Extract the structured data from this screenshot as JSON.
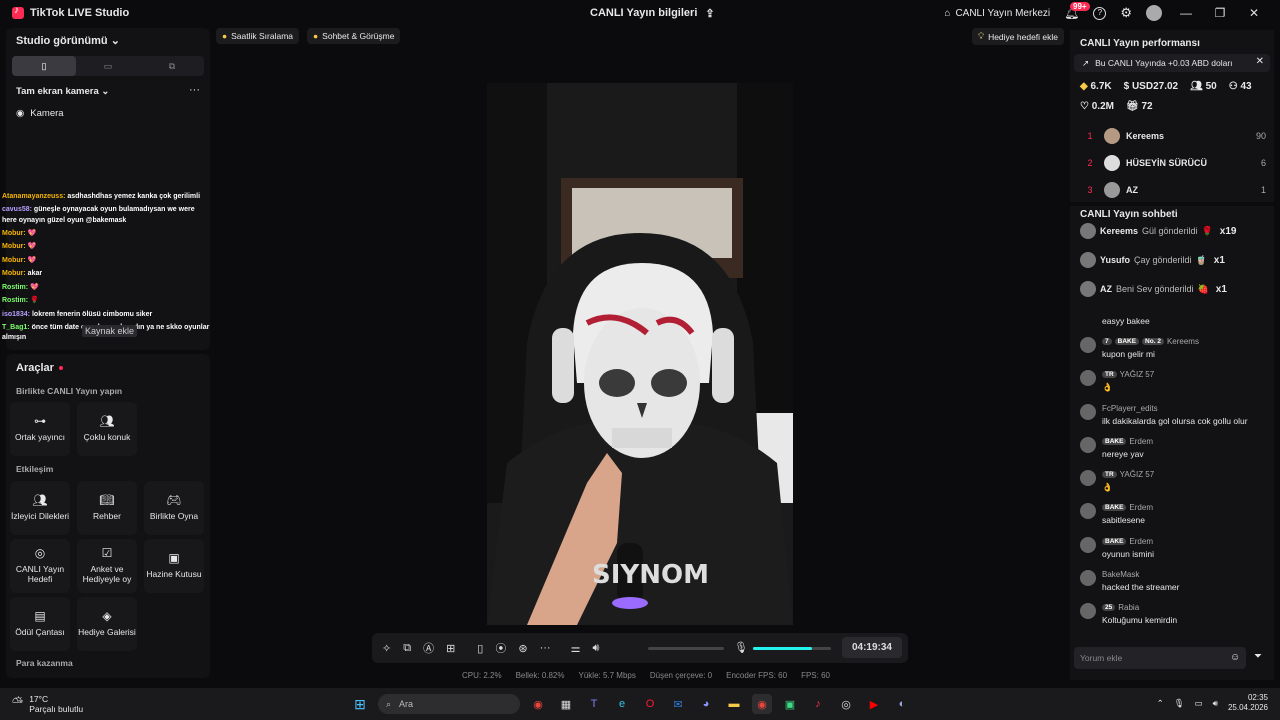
{
  "titlebar": {
    "app_name": "TikTok LIVE Studio",
    "center_title": "CANLI Yayın bilgileri",
    "live_center": "CANLI Yayın Merkezi",
    "notif_badge": "99+"
  },
  "left": {
    "studio_view": "Studio görünümü",
    "camera_title": "Tam ekran kamera",
    "camera_item": "Kamera",
    "source_add": "Kaynak ekle"
  },
  "overlay_chat": [
    {
      "user": "Atanamayanzeuss:",
      "text": "asdhashdhas yemez kanka çok gerilimli",
      "color": "#f7b500"
    },
    {
      "user": "cavus58:",
      "text": "güneşle oynayacak oyun bulamadıysan we were here oynayın güzel oyun @bakemask",
      "color": "#b8a0ff"
    },
    {
      "user": "Mobur:",
      "text": "💖",
      "color": "#f7b500"
    },
    {
      "user": "Mobur:",
      "text": "💖",
      "color": "#f7b500"
    },
    {
      "user": "Mobur:",
      "text": "💖",
      "color": "#f7b500"
    },
    {
      "user": "Mobur:",
      "text": "akar",
      "color": "#f7b500"
    },
    {
      "user": "Rostim:",
      "text": "💖",
      "color": "#7cff6b"
    },
    {
      "user": "Rostim:",
      "text": "🌹",
      "color": "#7cff6b"
    },
    {
      "user": "iso1834:",
      "text": "lokrem fenerin ölüsü cimbomu siker",
      "color": "#b8a0ff"
    },
    {
      "user": "T_Bag1:",
      "text": "önce tüm date oyunlarını alsaydın ya ne skko oyunlar almışın",
      "color": "#7cff6b"
    }
  ],
  "tools": {
    "title": "Araçlar",
    "section1": "Birlikte CANLI Yayın yapın",
    "section2": "Etkileşim",
    "section3": "Para kazanma",
    "items": [
      {
        "label": "Ortak yayıncı",
        "icon": "link-icon"
      },
      {
        "label": "Çoklu konuk",
        "icon": "users-icon"
      },
      {
        "label": "İzleyici Dilekleri",
        "icon": "audience-icon"
      },
      {
        "label": "Rehber",
        "icon": "guide-icon"
      },
      {
        "label": "Birlikte Oyna",
        "icon": "gamepad-icon"
      },
      {
        "label": "CANLI Yayın Hedefi",
        "icon": "target-icon"
      },
      {
        "label": "Anket ve Hediyeyle oy",
        "icon": "poll-icon"
      },
      {
        "label": "Hazine Kutusu",
        "icon": "treasure-icon"
      },
      {
        "label": "Ödül Çantası",
        "icon": "bag-icon"
      },
      {
        "label": "Hediye Galerisi",
        "icon": "gallery-icon"
      }
    ]
  },
  "top_chips": {
    "hourly": "Saatlik Sıralama",
    "chat_meet": "Sohbet & Görüşme",
    "gift_goal": "Hediye hedefi ekle"
  },
  "controls": {
    "timer": "04:19:34",
    "mic_level": 0.75
  },
  "stats": {
    "cpu": "CPU:  2.2%",
    "memory": "Bellek:  0.82%",
    "upload": "Yükle:  5.7 Mbps",
    "dropped": "Düşen çerçeve:  0",
    "encoder_fps": "Encoder FPS:  60",
    "fps": "FPS:  60"
  },
  "performance": {
    "title": "CANLI Yayın performansı",
    "banner": "Bu CANLI Yayında +0.03 ABD doları",
    "views": "6.7K",
    "usd": "USD27.02",
    "viewers": "50",
    "new_followers": "43",
    "likes": "0.2M",
    "gifts": "72",
    "ranking": [
      {
        "rank": "1",
        "name": "Kereems",
        "score": "90"
      },
      {
        "rank": "2",
        "name": "HÜSEYİN SÜRÜCÜ",
        "score": "6"
      },
      {
        "rank": "3",
        "name": "AZ",
        "score": "1"
      }
    ]
  },
  "chat": {
    "title": "CANLI Yayın sohbeti",
    "gifts": [
      {
        "user": "Kereems",
        "action": "Gül gönderildi",
        "emoji": "🌹",
        "count": "x19"
      },
      {
        "user": "Yusufo",
        "action": "Çay gönderildi",
        "emoji": "🧋",
        "count": "x1"
      },
      {
        "user": "AZ",
        "action": "Beni Sev gönderildi",
        "emoji": "🍓",
        "count": "x1"
      }
    ],
    "messages": [
      {
        "name": "",
        "tags": [],
        "text": "easyy bakee"
      },
      {
        "name": "Kereems",
        "tags": [
          "7",
          "BAKE",
          "No. 2"
        ],
        "text": "kupon gelir mi"
      },
      {
        "name": "YAĞIZ 57",
        "tags": [
          "TR"
        ],
        "text": "👌"
      },
      {
        "name": "FcPlayerr_edits",
        "tags": [],
        "text": "ilk dakikalarda gol olursa cok gollu olur"
      },
      {
        "name": "Erdem",
        "tags": [
          "BAKE"
        ],
        "text": "nereye yav"
      },
      {
        "name": "YAĞIZ 57",
        "tags": [
          "TR"
        ],
        "text": "👌"
      },
      {
        "name": "Erdem",
        "tags": [
          "BAKE"
        ],
        "text": "sabitlesene"
      },
      {
        "name": "Erdem",
        "tags": [
          "BAKE"
        ],
        "text": "oyunun ismini"
      },
      {
        "name": "BakeMask",
        "tags": [],
        "text": "hacked the streamer"
      },
      {
        "name": "Rabia",
        "tags": [
          "25"
        ],
        "text": "Koltuğumu kemirdin"
      }
    ],
    "comment_placeholder": "Yorum ekle"
  },
  "taskbar": {
    "temp": "17°C",
    "weather": "Parçalı bulutlu",
    "search": "Ara",
    "time": "02:35",
    "date": "25.04.2026"
  }
}
